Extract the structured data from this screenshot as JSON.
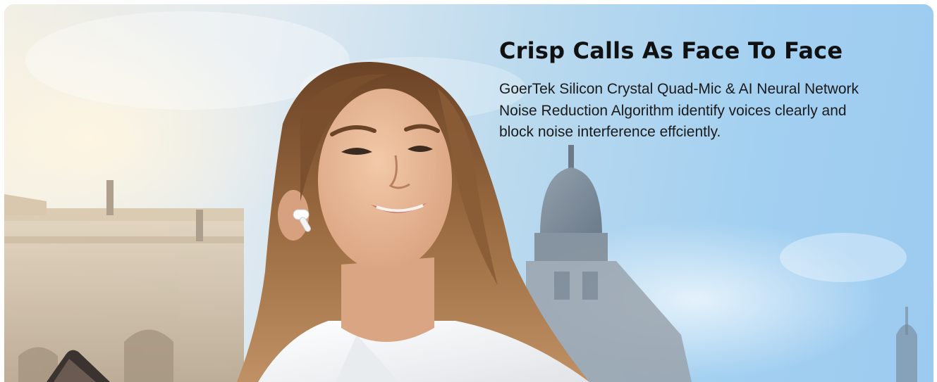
{
  "hero": {
    "headline": "Crisp Calls As Face To Face",
    "description": "GoerTek Silicon Crystal Quad-Mic & AI Neural Network Noise Reduction Algorithm identify voices clearly and block noise interference effciently."
  },
  "colors": {
    "sky": "#a3d0f1",
    "haze": "#f3efe4",
    "text": "#111111",
    "building": "#c9b79e",
    "dome": "#6f7a86",
    "hair": "#8a5a33",
    "skin": "#e8b896",
    "shirt": "#f4f4f2"
  }
}
